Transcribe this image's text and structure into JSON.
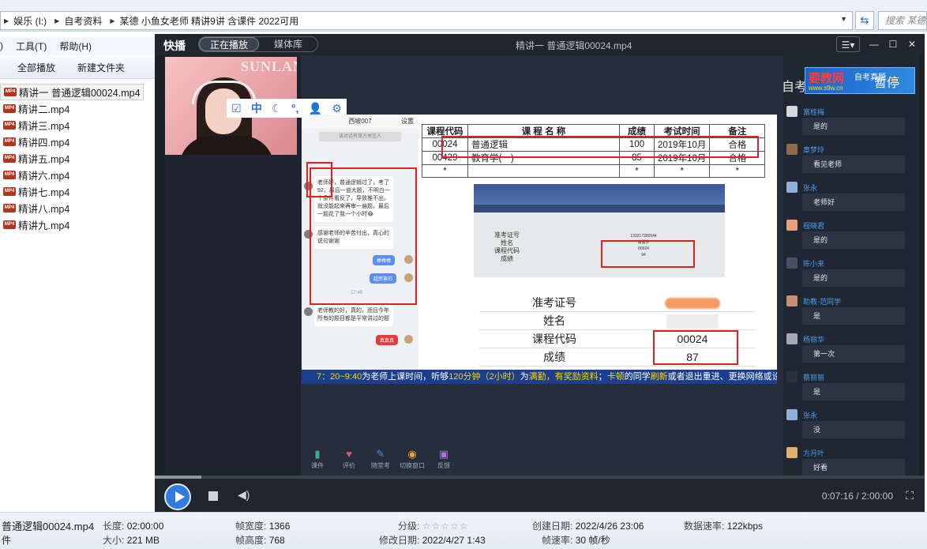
{
  "explorer": {
    "breadcrumbs": [
      "娱乐 (I:)",
      "自考资料",
      "某德 小鱼女老师 精讲9讲 含课件 2022可用"
    ],
    "search_placeholder": "搜索 某德",
    "menu": [
      "工具(T)",
      "帮助(H)"
    ],
    "toolbar": [
      "全部播放",
      "新建文件夹"
    ],
    "files": [
      {
        "name": "精讲一 普通逻辑00024.mp4",
        "selected": true
      },
      {
        "name": "精讲二.mp4"
      },
      {
        "name": "精讲三.mp4"
      },
      {
        "name": "精讲四.mp4"
      },
      {
        "name": "精讲五.mp4"
      },
      {
        "name": "精讲六.mp4"
      },
      {
        "name": "精讲七.mp4"
      },
      {
        "name": "精讲八.mp4"
      },
      {
        "name": "精讲九.mp4"
      }
    ]
  },
  "details": {
    "filename": "普通逻辑00024.mp4",
    "filetype": "件",
    "length_label": "长度:",
    "length": "02:00:00",
    "size_label": "大小:",
    "size": "221 MB",
    "width_label": "帧宽度:",
    "width": "1366",
    "height_label": "帧高度:",
    "height": "768",
    "rating_label": "分级:",
    "rating_stars": "☆☆☆☆☆",
    "modified_label": "修改日期:",
    "modified": "2022/4/27 1:43",
    "created_label": "创建日期:",
    "created": "2022/4/26 23:06",
    "framerate_label": "帧速率:",
    "framerate": "30 帧/秒",
    "datarate_label": "数据速率:",
    "datarate": "122kbps"
  },
  "player": {
    "app_name": "快播",
    "tabs": [
      "正在播放",
      "媒体库"
    ],
    "now_playing": "精讲一 普通逻辑00024.mp4",
    "time_current": "0:07:16",
    "time_total": "2:00:00",
    "progress": 0.06,
    "paused_label": "暂停"
  },
  "slide": {
    "cam_toolbar": [
      "中"
    ],
    "cam_sign": "SUNLANDS",
    "chat_title": "西坡007",
    "chat_settings": "设置",
    "chat_notice": "该对话有双方关注人",
    "chat_msg1": "老师好，普通逻辑过了，考了92，最后一道大题，不明白一个条件看反了，导致推不出，就没能起来再审一遍题，最后一题花了我一个小时😂",
    "chat_msg2": "感谢老师的辛苦付出，真心的说句谢谢",
    "chat_reply1": "棒棒棒",
    "chat_reply2": "超厉害的",
    "chat_time": "17:49",
    "chat_msg3": "老师教的好，真的，而且今年所有的题目都是平常讲过的题",
    "chat_reply3": "真真真",
    "score_headers": [
      "课程代码",
      "课 程 名 称",
      "成绩",
      "考试时间",
      "备注"
    ],
    "score_rows": [
      [
        "00024",
        "普通逻辑",
        "100",
        "2019年10月",
        "合格"
      ],
      [
        "00429",
        "教育学(一)",
        "85",
        "2019年10月",
        "合格"
      ],
      [
        "*",
        "",
        "*",
        "*",
        "*"
      ]
    ],
    "photo_labels": [
      "准考证号",
      "姓名",
      "课程代码",
      "成绩"
    ],
    "photo_values": [
      "133217300544",
      "谢晨芹",
      "00024",
      "94"
    ],
    "table2_labels": [
      "准考证号",
      "姓名",
      "课程代码",
      "成绩"
    ],
    "table2_code": "00024",
    "table2_score": "87",
    "banner_a": "7：20~9:40",
    "banner_b": "为老师上课时间，听够",
    "banner_c": "120分钟（2小时）",
    "banner_d": "为",
    "banner_e": "满勤，有奖励资料",
    "banner_f": "；",
    "banner_g": "卡顿",
    "banner_h": "的同学",
    "banner_i": "刷新",
    "banner_j": "或者退出重进、更换网络或设备~",
    "tools": [
      "课件",
      "评价",
      "随堂考",
      "切换窗口",
      "反馈"
    ],
    "tool_icons": [
      "book-icon",
      "thumb-icon",
      "pen-icon",
      "switch-icon",
      "feedback-icon"
    ]
  },
  "side": {
    "heading": "自考",
    "ad_brand": "要教网",
    "ad_sub": "自考真题",
    "ad_url": "www.s9w.cn",
    "messages": [
      {
        "name": "富桂梅",
        "text": "是的"
      },
      {
        "name": "章梦玲",
        "text": "看见老师"
      },
      {
        "name": "张永",
        "text": "老师好"
      },
      {
        "name": "程晓君",
        "text": "是的"
      },
      {
        "name": "陈小来",
        "text": "是的"
      },
      {
        "name": "助教-范同学",
        "text": "是"
      },
      {
        "name": "杨丽华",
        "text": "第一次"
      },
      {
        "name": "蔡丽丽",
        "text": "是"
      },
      {
        "name": "张永",
        "text": "没"
      },
      {
        "name": "方月叶",
        "text": "好看"
      }
    ]
  }
}
